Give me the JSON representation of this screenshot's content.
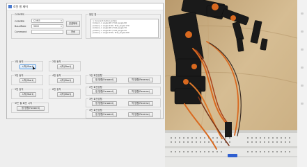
{
  "window": {
    "title": "로봇 팔 제어"
  },
  "com_settings": {
    "group_title": "COM포트",
    "port_label": "COM포트",
    "port_value": "COM3",
    "baud_label": "BaudRate",
    "baud_value": "9600",
    "command_label": "Command",
    "command_value": "",
    "connect_button": "연결해제",
    "send_button": "전송"
  },
  "motor_controls": [
    {
      "title": "1번 동작",
      "button": "시작(Start)"
    },
    {
      "title": "2번 동작",
      "button": "시작(Start)"
    },
    {
      "title": "3번 동작",
      "button": "시작(Start)"
    },
    {
      "title": "4번 동작",
      "button": "시작(Start)"
    },
    {
      "title": "5번 동작",
      "button": "시작(Start)"
    },
    {
      "title": "6번 동작",
      "button": "시작(Start)"
    }
  ],
  "dir_main": {
    "title": "모든 팔 회전 시작",
    "forward": "정 방향(Forward)"
  },
  "response": {
    "group_title": "응답 창",
    "lines": [
      "> Connect motion action",
      "[index] -> angle:90 / first_angle:90",
      "[index] -> angle:120 / first_angle:170",
      "[index] -> angle:90 / first_angle:70",
      "[index] -> angle:45 / first_angle:45",
      "[index] -> angle:150 / first_angle:200"
    ]
  },
  "direction_groups": [
    {
      "title": "1번 회전방향",
      "forward": "정 방향(Forward)",
      "reverse": "역 방향(Reverse)"
    },
    {
      "title": "2번 회전방향",
      "forward": "정 방향(Forward)",
      "reverse": "역 방향(Reverse)"
    },
    {
      "title": "3번 회전방향",
      "forward": "정 방향(Forward)",
      "reverse": "역 방향(Reverse)"
    },
    {
      "title": "4번 회전방향",
      "forward": "정 방향(Forward)",
      "reverse": "역 방향(Reverse)"
    }
  ],
  "colors": {
    "window_bg": "#f0f0f0",
    "accent": "#5a9be0",
    "cable_orange": "#d9691f",
    "robot_black": "#1a1a1a"
  }
}
